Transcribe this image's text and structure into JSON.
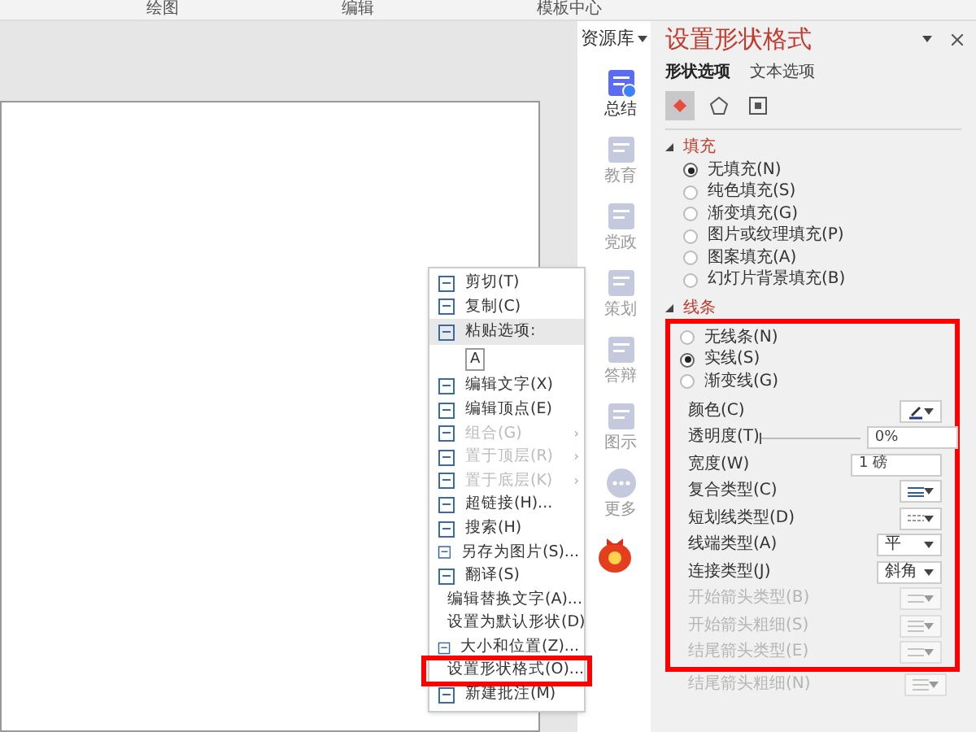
{
  "toolbar": {
    "groups": [
      "绘图",
      "编辑",
      "模板中心"
    ]
  },
  "resource_sidebar": {
    "title": "资源库",
    "items": [
      {
        "label": "总结",
        "selected": true
      },
      {
        "label": "教育",
        "selected": false
      },
      {
        "label": "党政",
        "selected": false
      },
      {
        "label": "策划",
        "selected": false
      },
      {
        "label": "答辩",
        "selected": false
      },
      {
        "label": "图示",
        "selected": false
      },
      {
        "label": "更多",
        "selected": false
      }
    ]
  },
  "context_menu": [
    {
      "kind": "item",
      "label": "剪切(T)",
      "disabled": false,
      "highlighted": false
    },
    {
      "kind": "item",
      "label": "复制(C)",
      "disabled": false,
      "highlighted": false
    },
    {
      "kind": "header",
      "label": "粘贴选项:"
    },
    {
      "kind": "paste",
      "label": "A"
    },
    {
      "kind": "item",
      "label": "编辑文字(X)",
      "disabled": false,
      "highlighted": false
    },
    {
      "kind": "item",
      "label": "编辑顶点(E)",
      "disabled": false,
      "highlighted": false
    },
    {
      "kind": "item",
      "label": "组合(G)",
      "disabled": true,
      "submenu_arrow": "›",
      "highlighted": false
    },
    {
      "kind": "item",
      "label": "置于顶层(R)",
      "disabled": true,
      "submenu_arrow": "›",
      "highlighted": false
    },
    {
      "kind": "item",
      "label": "置于底层(K)",
      "disabled": true,
      "submenu_arrow": "›",
      "highlighted": false
    },
    {
      "kind": "item",
      "label": "超链接(H)...",
      "disabled": false,
      "highlighted": false
    },
    {
      "kind": "item",
      "label": "搜索(H)",
      "disabled": false,
      "highlighted": false
    },
    {
      "kind": "item",
      "label": "另存为图片(S)...",
      "disabled": false,
      "highlighted": false
    },
    {
      "kind": "item",
      "label": "翻译(S)",
      "disabled": false,
      "highlighted": false
    },
    {
      "kind": "item",
      "label": "编辑替换文字(A)...",
      "disabled": false,
      "highlighted": false
    },
    {
      "kind": "item",
      "label": "设置为默认形状(D)",
      "disabled": false,
      "highlighted": false
    },
    {
      "kind": "item",
      "label": "大小和位置(Z)...",
      "disabled": false,
      "highlighted": false
    },
    {
      "kind": "item",
      "label": "设置形状格式(O)...",
      "disabled": false,
      "highlighted": true
    },
    {
      "kind": "item",
      "label": "新建批注(M)",
      "disabled": false,
      "highlighted": false
    }
  ],
  "format_panel": {
    "title": "设置形状格式",
    "tabs": [
      {
        "label": "形状选项",
        "selected": true
      },
      {
        "label": "文本选项",
        "selected": false
      }
    ],
    "icon_tabs": [
      {
        "kind": "fill",
        "selected": true
      },
      {
        "kind": "effects",
        "selected": false
      },
      {
        "kind": "size",
        "selected": false
      }
    ],
    "fill_section": {
      "title": "填充",
      "expanded": true,
      "options": [
        {
          "label": "无填充(N)",
          "selected": true
        },
        {
          "label": "纯色填充(S)",
          "selected": false
        },
        {
          "label": "渐变填充(G)",
          "selected": false
        },
        {
          "label": "图片或纹理填充(P)",
          "selected": false
        },
        {
          "label": "图案填充(A)",
          "selected": false
        },
        {
          "label": "幻灯片背景填充(B)",
          "selected": false
        }
      ]
    },
    "line_section": {
      "title": "线条",
      "expanded": true,
      "options": [
        {
          "label": "无线条(N)",
          "selected": false
        },
        {
          "label": "实线(S)",
          "selected": true
        },
        {
          "label": "渐变线(G)",
          "selected": false
        }
      ],
      "properties": [
        {
          "kind": "color",
          "label": "颜色(C)",
          "disabled": false
        },
        {
          "kind": "slider",
          "label": "透明度(T)",
          "value": "0%",
          "level": 0,
          "disabled": false
        },
        {
          "kind": "spinner",
          "label": "宽度(W)",
          "value": "1 磅",
          "disabled": false
        },
        {
          "kind": "compound",
          "label": "复合类型(C)",
          "disabled": false
        },
        {
          "kind": "dash",
          "label": "短划线类型(D)",
          "disabled": false
        },
        {
          "kind": "text",
          "label": "线端类型(A)",
          "value": "平",
          "disabled": false
        },
        {
          "kind": "text",
          "label": "连接类型(J)",
          "value": "斜角",
          "disabled": false
        },
        {
          "kind": "arrow",
          "label": "开始箭头类型(B)",
          "disabled": true
        },
        {
          "kind": "weight",
          "label": "开始箭头粗细(S)",
          "disabled": true
        },
        {
          "kind": "arrow",
          "label": "结尾箭头类型(E)",
          "disabled": true
        },
        {
          "kind": "weight",
          "label": "结尾箭头粗细(N)",
          "disabled": true
        }
      ]
    }
  }
}
